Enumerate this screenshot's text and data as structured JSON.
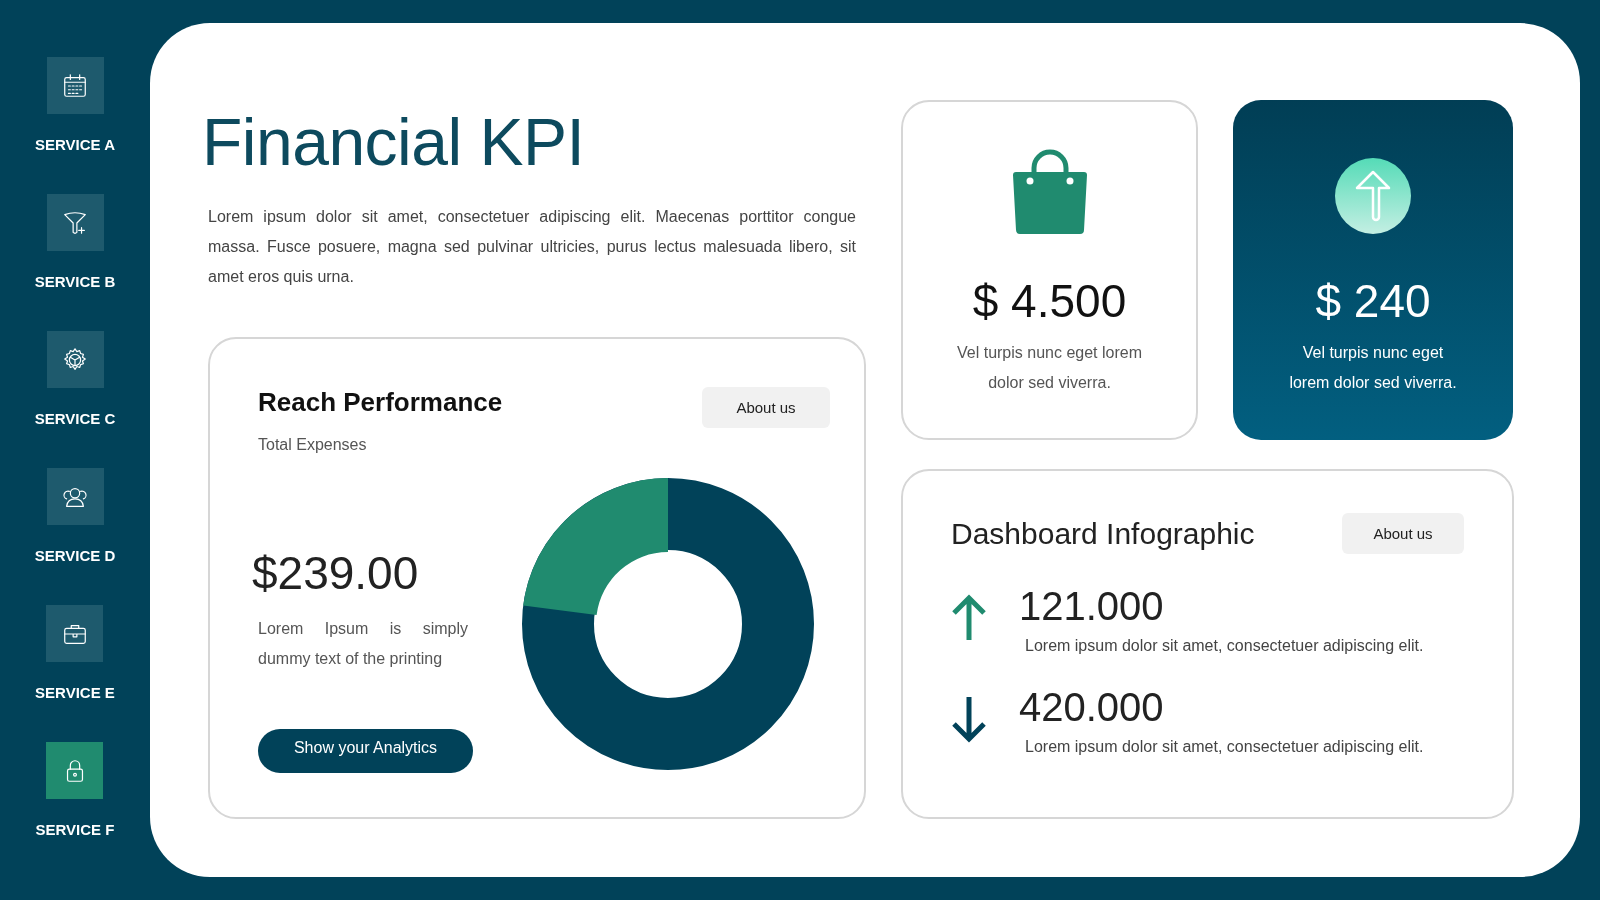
{
  "sidebar": {
    "items": [
      {
        "label": "SERVICE A",
        "kind": "calendar",
        "selected": false
      },
      {
        "label": "SERVICE B",
        "kind": "funnel",
        "selected": false
      },
      {
        "label": "SERVICE C",
        "kind": "gear",
        "selected": false
      },
      {
        "label": "SERVICE D",
        "kind": "people",
        "selected": false
      },
      {
        "label": "SERVICE E",
        "kind": "briefcase",
        "selected": false
      },
      {
        "label": "SERVICE F",
        "kind": "lock",
        "selected": true
      }
    ]
  },
  "header": {
    "title": "Financial KPI",
    "description": "Lorem ipsum dolor sit amet, consectetuer adipiscing elit. Maecenas porttitor congue massa. Fusce posuere, magna sed pulvinar ultricies, purus lectus malesuada libero, sit amet eros quis urna."
  },
  "reach_card": {
    "title": "Reach Performance",
    "subtitle": "Total Expenses",
    "button": "About us",
    "amount": "$239.00",
    "note": "Lorem Ipsum is simply dummy text of the printing",
    "action": "Show your Analytics"
  },
  "stat_cards": [
    {
      "kind": "light",
      "value": "$ 4.500",
      "text": "Vel turpis nunc eget lorem dolor sed viverra."
    },
    {
      "kind": "dark",
      "value": "$ 240",
      "text": "Vel turpis nunc eget lorem dolor sed viverra."
    }
  ],
  "dashboard": {
    "title": "Dashboard Infographic",
    "button": "About us",
    "metrics": [
      {
        "kind": "up",
        "value": "121.000",
        "text": "Lorem ipsum dolor sit amet, consectetuer adipiscing elit."
      },
      {
        "kind": "down",
        "value": "420.000",
        "text": "Lorem ipsum dolor sit amet, consectetuer adipiscing elit."
      }
    ]
  }
}
